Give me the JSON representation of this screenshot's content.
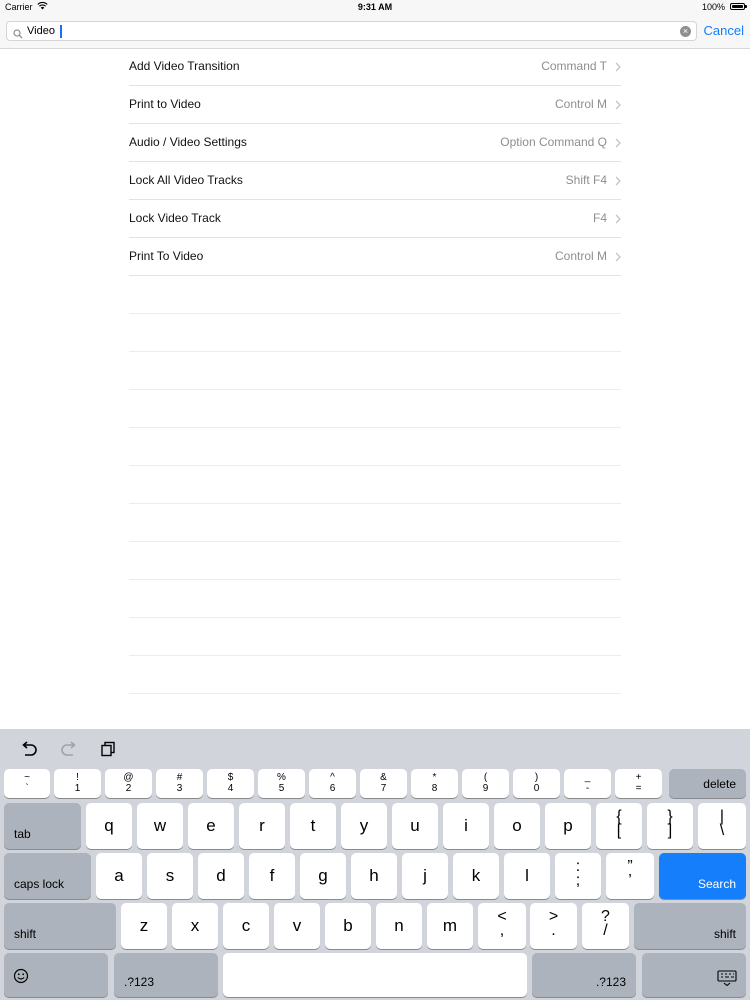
{
  "status_bar": {
    "carrier": "Carrier",
    "time": "9:31 AM",
    "battery": "100%"
  },
  "search": {
    "value": "Video",
    "cancel_label": "Cancel"
  },
  "results": [
    {
      "title": "Add Video Transition",
      "shortcut": "Command T"
    },
    {
      "title": "Print to Video",
      "shortcut": "Control M"
    },
    {
      "title": "Audio / Video Settings",
      "shortcut": "Option Command Q"
    },
    {
      "title": "Lock All Video Tracks",
      "shortcut": "Shift F4"
    },
    {
      "title": "Lock Video Track",
      "shortcut": "F4"
    },
    {
      "title": "Print To Video",
      "shortcut": "Control M"
    }
  ],
  "keyboard": {
    "toolbar_icons": [
      "undo-icon",
      "redo-icon",
      "paste-icon"
    ],
    "number_row": [
      {
        "top": "~",
        "bottom": "`"
      },
      {
        "top": "!",
        "bottom": "1"
      },
      {
        "top": "@",
        "bottom": "2"
      },
      {
        "top": "#",
        "bottom": "3"
      },
      {
        "top": "$",
        "bottom": "4"
      },
      {
        "top": "%",
        "bottom": "5"
      },
      {
        "top": "^",
        "bottom": "6"
      },
      {
        "top": "&",
        "bottom": "7"
      },
      {
        "top": "*",
        "bottom": "8"
      },
      {
        "top": "(",
        "bottom": "9"
      },
      {
        "top": ")",
        "bottom": "0"
      },
      {
        "top": "_",
        "bottom": "-"
      },
      {
        "top": "+",
        "bottom": "="
      }
    ],
    "delete_label": "delete",
    "tab_label": "tab",
    "row_q": [
      "q",
      "w",
      "e",
      "r",
      "t",
      "y",
      "u",
      "i",
      "o",
      "p"
    ],
    "row_q_punct": [
      {
        "top": "{",
        "bottom": "["
      },
      {
        "top": "}",
        "bottom": "]"
      },
      {
        "top": "|",
        "bottom": "\\"
      }
    ],
    "caps_label": "caps lock",
    "row_a": [
      "a",
      "s",
      "d",
      "f",
      "g",
      "h",
      "j",
      "k",
      "l"
    ],
    "row_a_punct": [
      {
        "top": ":",
        "bottom": ";"
      },
      {
        "top": "”",
        "bottom": "’"
      }
    ],
    "search_label": "Search",
    "shift_label": "shift",
    "row_z": [
      "z",
      "x",
      "c",
      "v",
      "b",
      "n",
      "m"
    ],
    "row_z_punct": [
      {
        "top": "<",
        "bottom": ","
      },
      {
        "top": ">",
        "bottom": "."
      },
      {
        "top": "?",
        "bottom": "/"
      }
    ],
    "numbers_label": ".?123",
    "icons": [
      "emoji-icon",
      "keyboard-dismiss-icon"
    ],
    "accent_color": "#147efb"
  }
}
